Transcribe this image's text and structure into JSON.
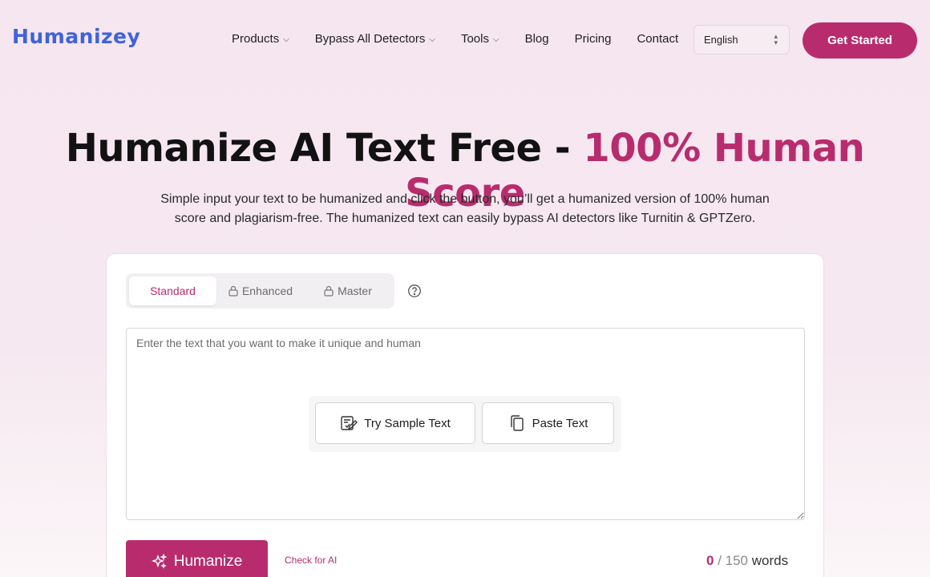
{
  "header": {
    "logo": "Humanizey",
    "nav": [
      {
        "label": "Products",
        "dropdown": true
      },
      {
        "label": "Bypass All Detectors",
        "dropdown": true
      },
      {
        "label": "Tools",
        "dropdown": true
      },
      {
        "label": "Blog",
        "dropdown": false
      },
      {
        "label": "Pricing",
        "dropdown": false
      },
      {
        "label": "Contact",
        "dropdown": false
      }
    ],
    "language": "English",
    "cta_label": "Get Started"
  },
  "hero": {
    "title_main": "Humanize AI Text Free - ",
    "title_accent": "100% Human Score",
    "subtitle": "Simple input your text to be humanized and click the button, you’ll get a humanized version of 100% human score and plagiarism-free. The humanized text can easily bypass AI detectors like Turnitin & GPTZero."
  },
  "editor": {
    "tabs": [
      {
        "label": "Standard",
        "active": true,
        "locked": false
      },
      {
        "label": "Enhanced",
        "active": false,
        "locked": true
      },
      {
        "label": "Master",
        "active": false,
        "locked": true
      }
    ],
    "placeholder": "Enter the text that you want to make it unique and human",
    "try_sample_label": "Try Sample Text",
    "paste_label": "Paste Text",
    "humanize_label": "Humanize",
    "check_ai_label": "Check for AI",
    "word_count": "0",
    "word_limit": "/ 150",
    "words_label": "words"
  },
  "colors": {
    "brand": "#b82c6e",
    "logo": "#3f63dd"
  },
  "icons": [
    "chevron-down-icon",
    "updown-icon",
    "lock-icon",
    "help-icon",
    "sample-text-icon",
    "paste-icon",
    "sparkle-icon"
  ]
}
